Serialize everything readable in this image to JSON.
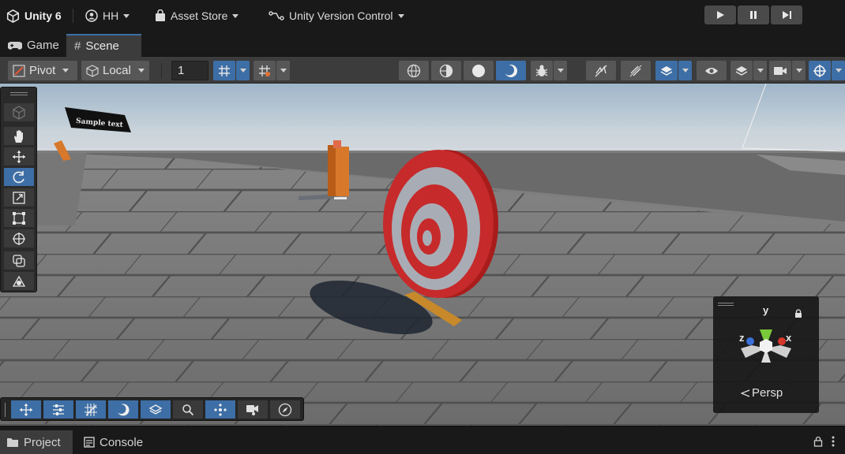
{
  "topbar": {
    "account": "Unity 6",
    "user": "HH",
    "asset_store": "Asset Store",
    "version_control": "Unity Version Control"
  },
  "tabs": [
    {
      "label": "Game",
      "icon": "gamepad-icon"
    },
    {
      "label": "Scene",
      "icon": "hash-icon",
      "active": true
    }
  ],
  "scene_toolbar": {
    "pivot_label": "Pivot",
    "local_label": "Local",
    "snap_increment": "1"
  },
  "scene": {
    "sample_text": "Sample text"
  },
  "gizmo": {
    "projection_label": "Persp",
    "axis_y": "y",
    "axis_x": "x",
    "axis_z": "z",
    "colors": {
      "x": "#d5372a",
      "y": "#7ac93a",
      "z": "#3a6fd8"
    }
  },
  "bottom_tabs": [
    {
      "label": "Project",
      "icon": "folder-icon"
    },
    {
      "label": "Console",
      "icon": "console-icon"
    }
  ],
  "colors": {
    "accent": "#3e6ea6",
    "panel_bg": "#191919",
    "toolbar_bg": "#3c3c3c"
  }
}
